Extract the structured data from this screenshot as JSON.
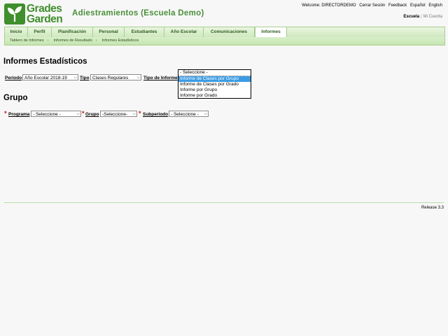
{
  "logo": {
    "line1": "Grades",
    "line2": "Garden"
  },
  "app_title": "Adiestramientos (Escuela Demo)",
  "top_links": {
    "welcome": "Welcome: DIRECTORDEMO",
    "logout": "Cerrar Sesión",
    "feedback": "Feedback",
    "lang_es": "Español",
    "lang_en": "English"
  },
  "school_links": {
    "school": "Escuela",
    "separator": "|",
    "account": "Mi Cuenta"
  },
  "nav": {
    "items": [
      "Inicio",
      "Perfil",
      "Planificación",
      "Personal",
      "Estudiantes",
      "Año Escolar",
      "Comunicaciones",
      "Informes"
    ],
    "active": "Informes"
  },
  "breadcrumb": [
    "Tablero de Informes",
    "Informes de Resultado",
    "Informes Estadísticos"
  ],
  "page_title": "Informes Estadísticos",
  "filters": {
    "period_label": "Periodo",
    "period_value": "Año Escolar 2018-19",
    "type_label": "Tipo",
    "type_value": "Clases Regulares",
    "report_type_label": "Tipo de Informe",
    "report_type_current": "- Seleccione -",
    "report_type_options": [
      "Informe de Clases por Grupo",
      "Informe de Clases por Grado",
      "Informe por Grupo",
      "Informe por Grado"
    ],
    "report_type_highlighted": "Informe de Clases por Grupo"
  },
  "group_section": {
    "title": "Grupo",
    "program_label": "Programa",
    "program_value": "- Seleccione -",
    "group_label": "Grupo",
    "group_value": "-Seleccione-",
    "subperiod_label": "Subperiodo",
    "subperiod_value": "- Seleccione -",
    "required_mark": "*"
  },
  "footer": {
    "release": "Release 3.3"
  },
  "colors": {
    "brand_green": "#3f8f2c",
    "title_green": "#4a8f3a",
    "highlight": "#3b9ce4",
    "required": "#d01010"
  }
}
